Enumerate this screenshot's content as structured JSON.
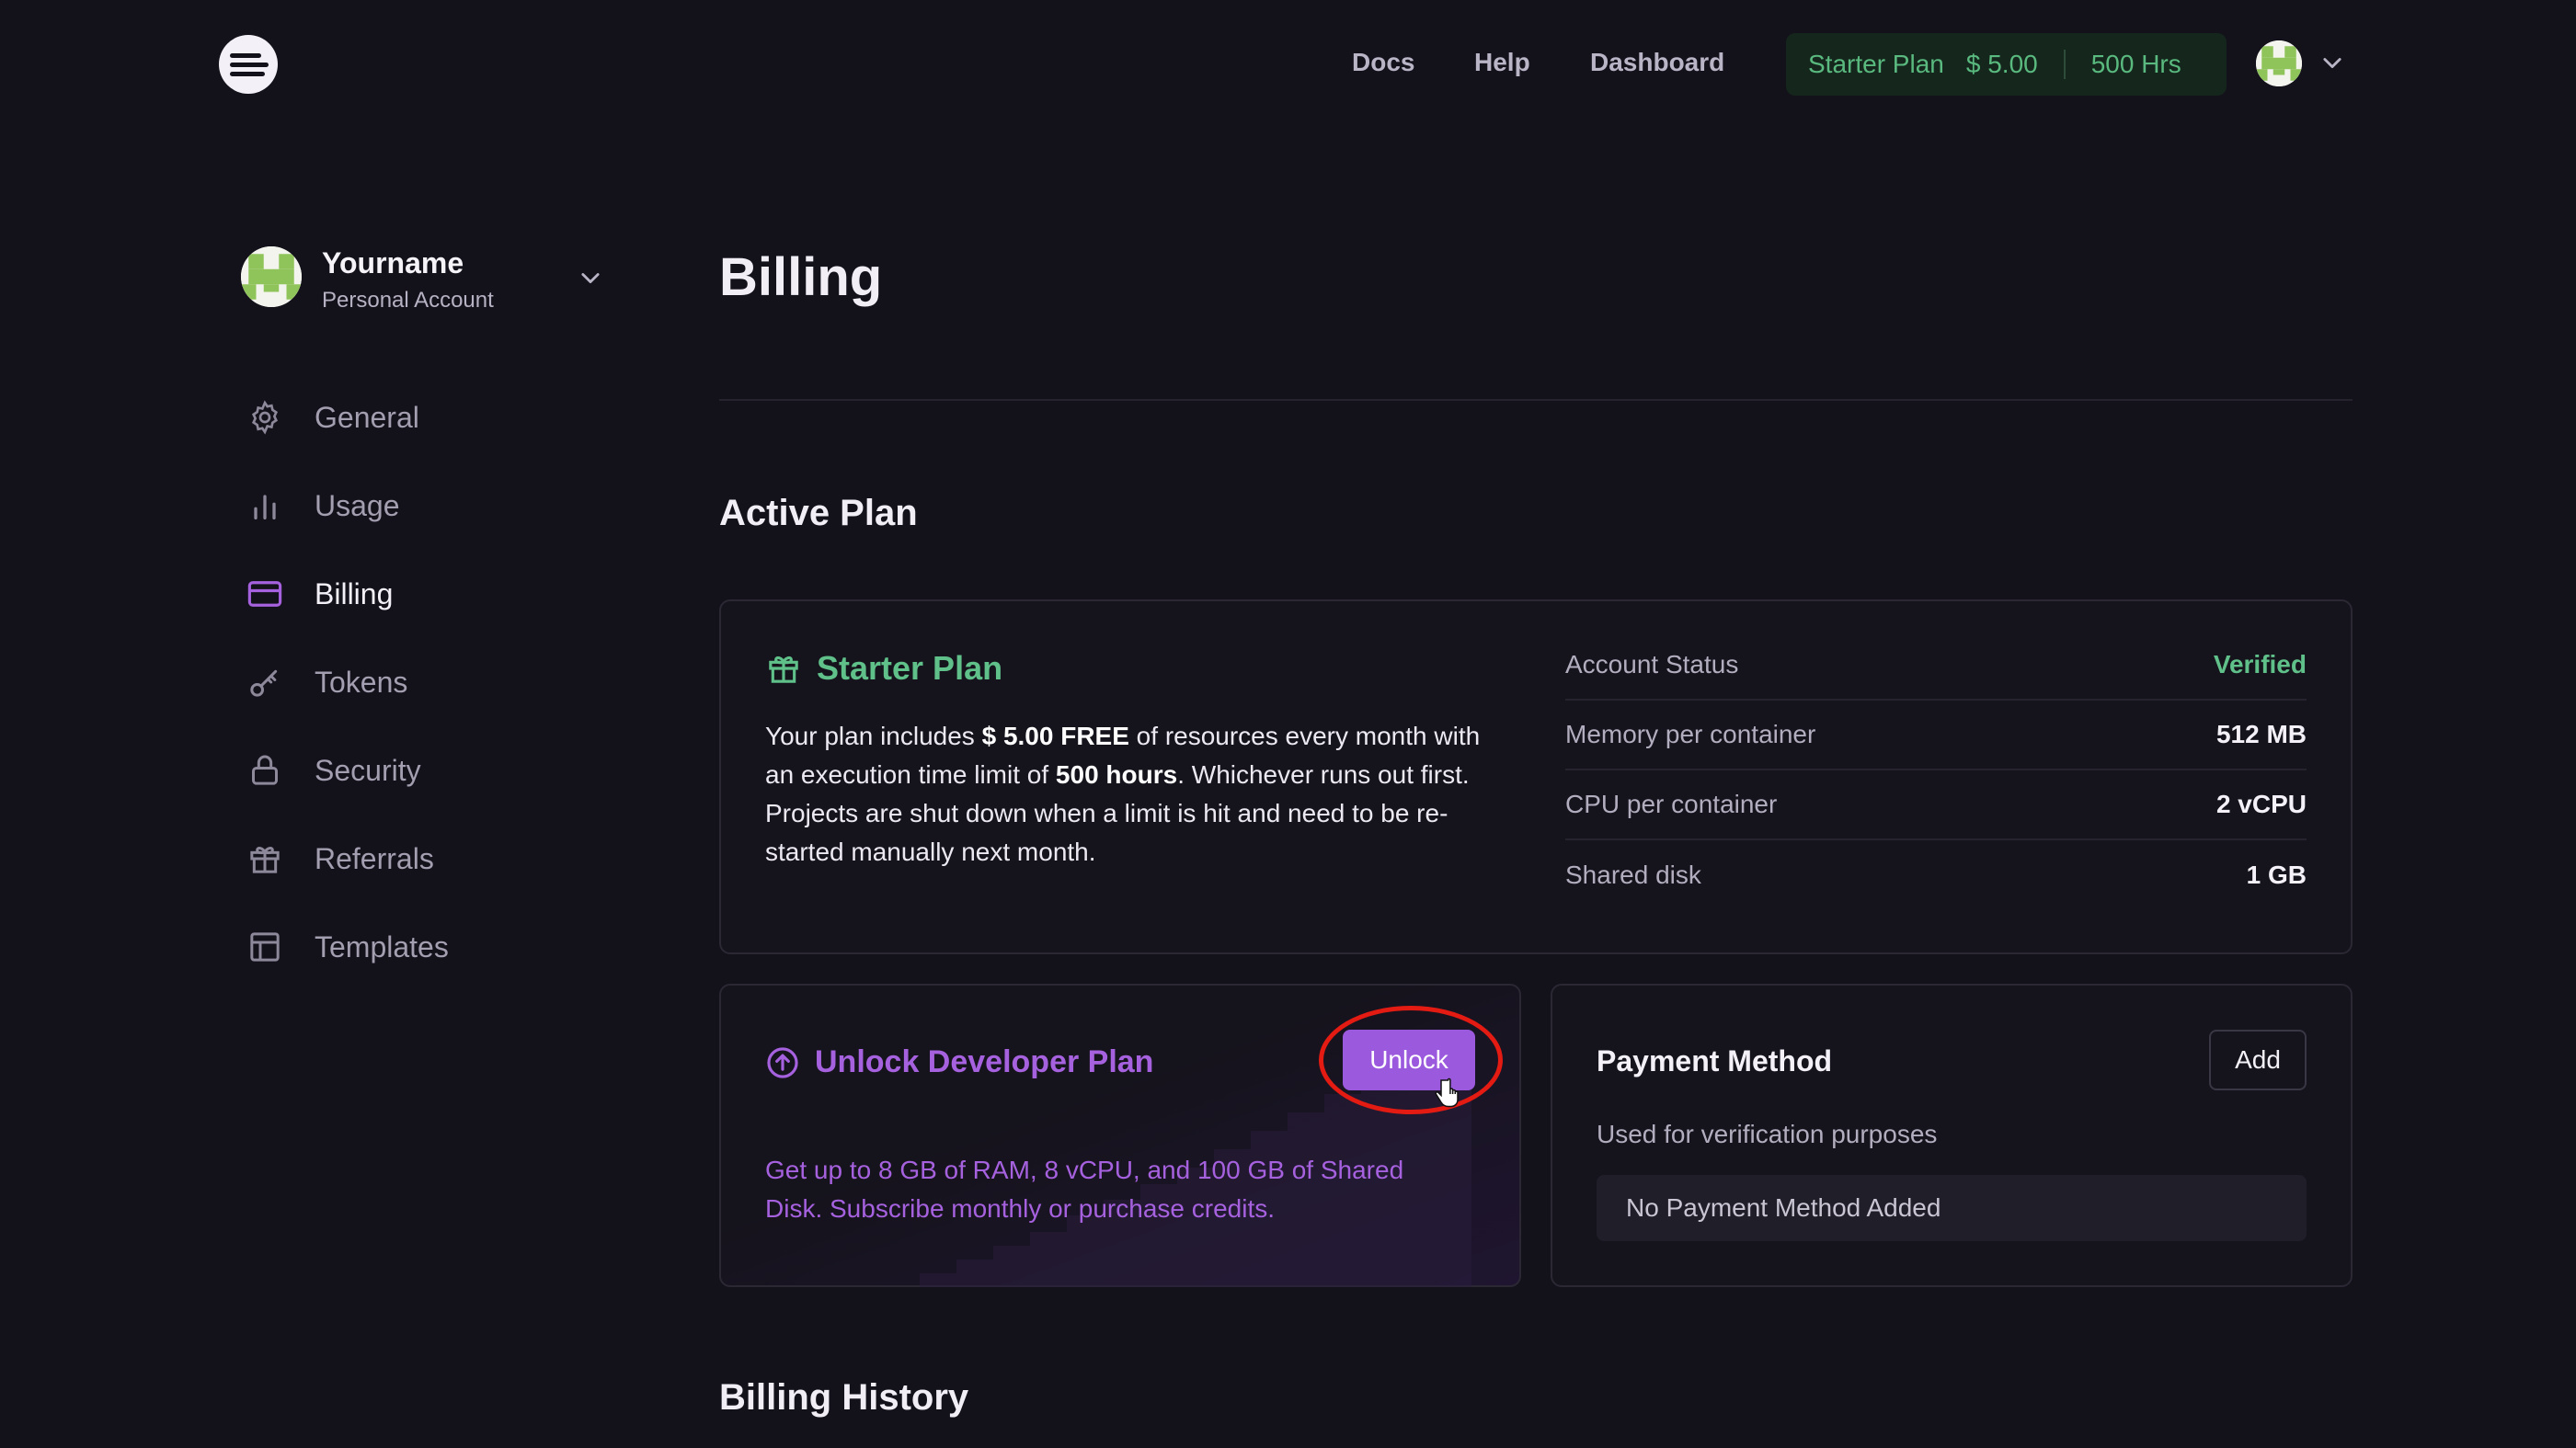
{
  "topnav": {
    "links": [
      "Docs",
      "Help",
      "Dashboard"
    ],
    "plan_pill": {
      "plan": "Starter Plan",
      "price": "$ 5.00",
      "hours": "500 Hrs"
    }
  },
  "account": {
    "name": "Yourname",
    "type": "Personal Account"
  },
  "sidebar": {
    "items": [
      {
        "label": "General",
        "icon": "gear-icon"
      },
      {
        "label": "Usage",
        "icon": "bar-chart-icon"
      },
      {
        "label": "Billing",
        "icon": "credit-card-icon",
        "active": true
      },
      {
        "label": "Tokens",
        "icon": "key-icon"
      },
      {
        "label": "Security",
        "icon": "lock-icon"
      },
      {
        "label": "Referrals",
        "icon": "gift-icon"
      },
      {
        "label": "Templates",
        "icon": "layout-icon"
      }
    ]
  },
  "main": {
    "title": "Billing",
    "active_plan_heading": "Active Plan",
    "plan": {
      "name": "Starter Plan",
      "desc_1": "Your plan includes ",
      "desc_amount": "$ 5.00 FREE",
      "desc_2": " of resources every month with an execution time limit of ",
      "desc_hours": "500 hours",
      "desc_3": ". Whichever runs out first. Projects are shut down when a limit is hit and need to be re-started manually next month.",
      "specs": [
        {
          "key": "Account Status",
          "value": "Verified"
        },
        {
          "key": "Memory per container",
          "value": "512 MB"
        },
        {
          "key": "CPU per container",
          "value": "2 vCPU"
        },
        {
          "key": "Shared disk",
          "value": "1 GB"
        }
      ]
    },
    "unlock": {
      "title": "Unlock Developer Plan",
      "button": "Unlock",
      "desc": "Get up to 8 GB of RAM, 8 vCPU, and 100 GB of Shared Disk. Subscribe monthly or purchase credits."
    },
    "payment": {
      "title": "Payment Method",
      "subtitle": "Used for verification purposes",
      "add_button": "Add",
      "empty": "No Payment Method Added"
    },
    "billing_history_heading": "Billing History"
  },
  "colors": {
    "green": "#5fc089",
    "purple": "#9b59de",
    "highlight": "#e31b12"
  }
}
